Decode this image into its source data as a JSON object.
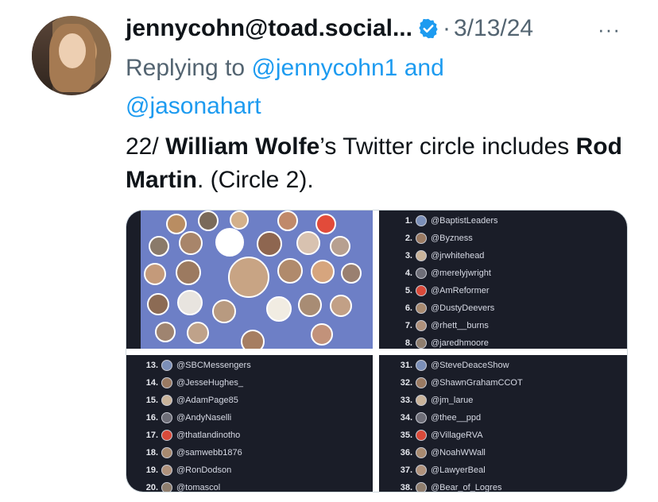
{
  "post": {
    "display_name": "jennycohn@toad.social...",
    "separator": "·",
    "date": "3/13/24",
    "more": "···",
    "reply_prefix": "Replying to",
    "reply_user1": "@jennycohn1",
    "reply_and": "and",
    "reply_user2": "@jasonahart",
    "text_prefix": "22/",
    "text_name1": "William Wolfe",
    "text_mid": "’s Twitter circle includes",
    "text_name2": "Rod Martin",
    "text_suffix": ". (Circle 2)."
  },
  "colors": {
    "link": "#1d9bf0",
    "secondary": "#536471",
    "panel_dark": "#1a1d28",
    "panel_blue": "#6d7fc6"
  },
  "icons": {
    "verified": "verified-badge-icon",
    "more": "more-options-icon"
  },
  "media": {
    "list_top_right": [
      {
        "num": "1.",
        "handle": "@BaptistLeaders"
      },
      {
        "num": "2.",
        "handle": "@Byzness"
      },
      {
        "num": "3.",
        "handle": "@jrwhitehead"
      },
      {
        "num": "4.",
        "handle": "@merelyjwright"
      },
      {
        "num": "5.",
        "handle": "@AmReformer"
      },
      {
        "num": "6.",
        "handle": "@DustyDeevers"
      },
      {
        "num": "7.",
        "handle": "@rhett__burns"
      },
      {
        "num": "8.",
        "handle": "@jaredhmoore"
      }
    ],
    "list_bottom_left": [
      {
        "num": "13.",
        "handle": "@SBCMessengers"
      },
      {
        "num": "14.",
        "handle": "@JesseHughes_"
      },
      {
        "num": "15.",
        "handle": "@AdamPage85"
      },
      {
        "num": "16.",
        "handle": "@AndyNaselli"
      },
      {
        "num": "17.",
        "handle": "@thatlandinotho"
      },
      {
        "num": "18.",
        "handle": "@samwebb1876"
      },
      {
        "num": "19.",
        "handle": "@RonDodson"
      },
      {
        "num": "20.",
        "handle": "@tomascol"
      }
    ],
    "list_bottom_right": [
      {
        "num": "31.",
        "handle": "@SteveDeaceShow"
      },
      {
        "num": "32.",
        "handle": "@ShawnGrahamCCOT"
      },
      {
        "num": "33.",
        "handle": "@jm_larue"
      },
      {
        "num": "34.",
        "handle": "@thee__ppd"
      },
      {
        "num": "35.",
        "handle": "@VillageRVA"
      },
      {
        "num": "36.",
        "handle": "@NoahWWall"
      },
      {
        "num": "37.",
        "handle": "@LawyerBeal"
      },
      {
        "num": "38.",
        "handle": "@Bear_of_Logres"
      }
    ]
  }
}
